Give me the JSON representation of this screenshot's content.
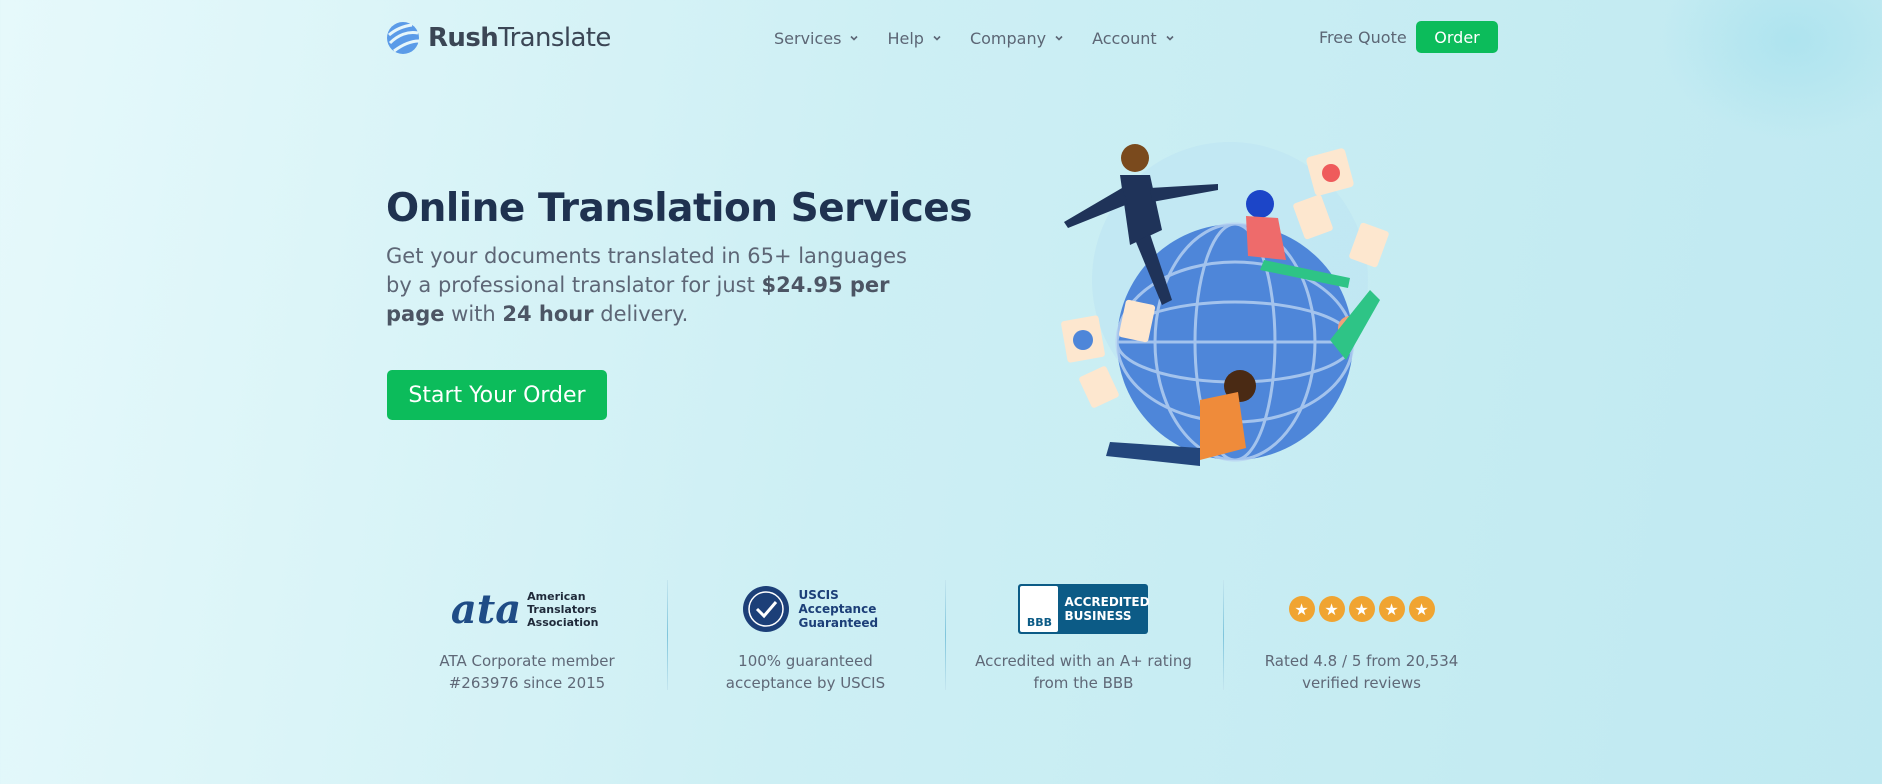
{
  "header": {
    "brand_bold": "Rush",
    "brand_light": "Translate",
    "menu": [
      {
        "label": "Services"
      },
      {
        "label": "Help"
      },
      {
        "label": "Company"
      },
      {
        "label": "Account"
      }
    ],
    "free_quote": "Free Quote",
    "order": "Order"
  },
  "hero": {
    "title": "Online Translation Services",
    "sub_1": "Get your documents translated in 65+ languages by a professional translator for just ",
    "sub_price": "$24.95 per page",
    "sub_2": " with ",
    "sub_time": "24 hour",
    "sub_3": " delivery.",
    "cta": "Start Your Order"
  },
  "badges": [
    {
      "logo_text": "ata",
      "logo_caption": "American Translators Association",
      "line1": "ATA Corporate member",
      "line2": "#263976 since 2015"
    },
    {
      "logo_text": "USCIS Acceptance Guaranteed",
      "line1": "100% guaranteed",
      "line2": "acceptance by USCIS"
    },
    {
      "logo_text": "ACCREDITED BUSINESS",
      "logo_mark": "BBB",
      "line1": "Accredited with an A+ rating",
      "line2": "from the BBB"
    },
    {
      "stars": 5,
      "line1": "Rated 4.8 / 5 from 20,534",
      "line2": "verified reviews"
    }
  ],
  "colors": {
    "accent": "#0cbc5b",
    "heading": "#1f3250",
    "star": "#f0a431",
    "bbb": "#0c5b86"
  }
}
